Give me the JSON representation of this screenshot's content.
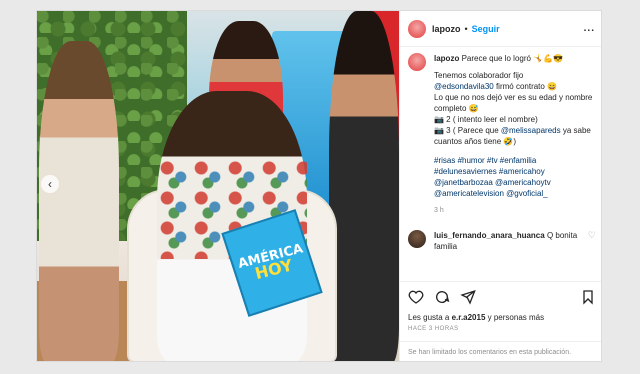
{
  "post": {
    "username": "lapozo",
    "follow_label": "Seguir",
    "more_label": "...",
    "caption_text": "Parece que lo logró 🤸💪😎",
    "caption_lines": [
      "Tenemos colaborador fijo",
      "@edsondavila30",
      " firmó contrato 😄",
      "Lo que no nos dejó ver es su edad y nombre completo 😅",
      "📷 2 ( intento leer el nombre)",
      "📷 3 ( Parece que ",
      "@melissapareds",
      " ya sabe cuantos años tiene 🤣)"
    ],
    "hashtags": "#risas #humor #tv #enfamilia #delunesaviernes #americahoy @janetbarbozaa @americahoytv @americatelevision @gvoficial_",
    "time_ago": "3 h",
    "comment": {
      "username": "luis_fernando_anara_huanca",
      "text": "Q bonita familia"
    },
    "likes_prefix": "Les gusta a ",
    "likes_user": "e.r.a2015",
    "likes_suffix": " y personas más",
    "posted_label": "HACE 3 HORAS",
    "comments_limited": "Se han limitado los comentarios en esta publicación."
  },
  "photo": {
    "folder_line1": "AMÉRICA",
    "folder_line2": "HOY"
  },
  "icons": [
    "heart-icon",
    "comment-icon",
    "share-icon",
    "bookmark-icon",
    "chevron-left-icon"
  ]
}
